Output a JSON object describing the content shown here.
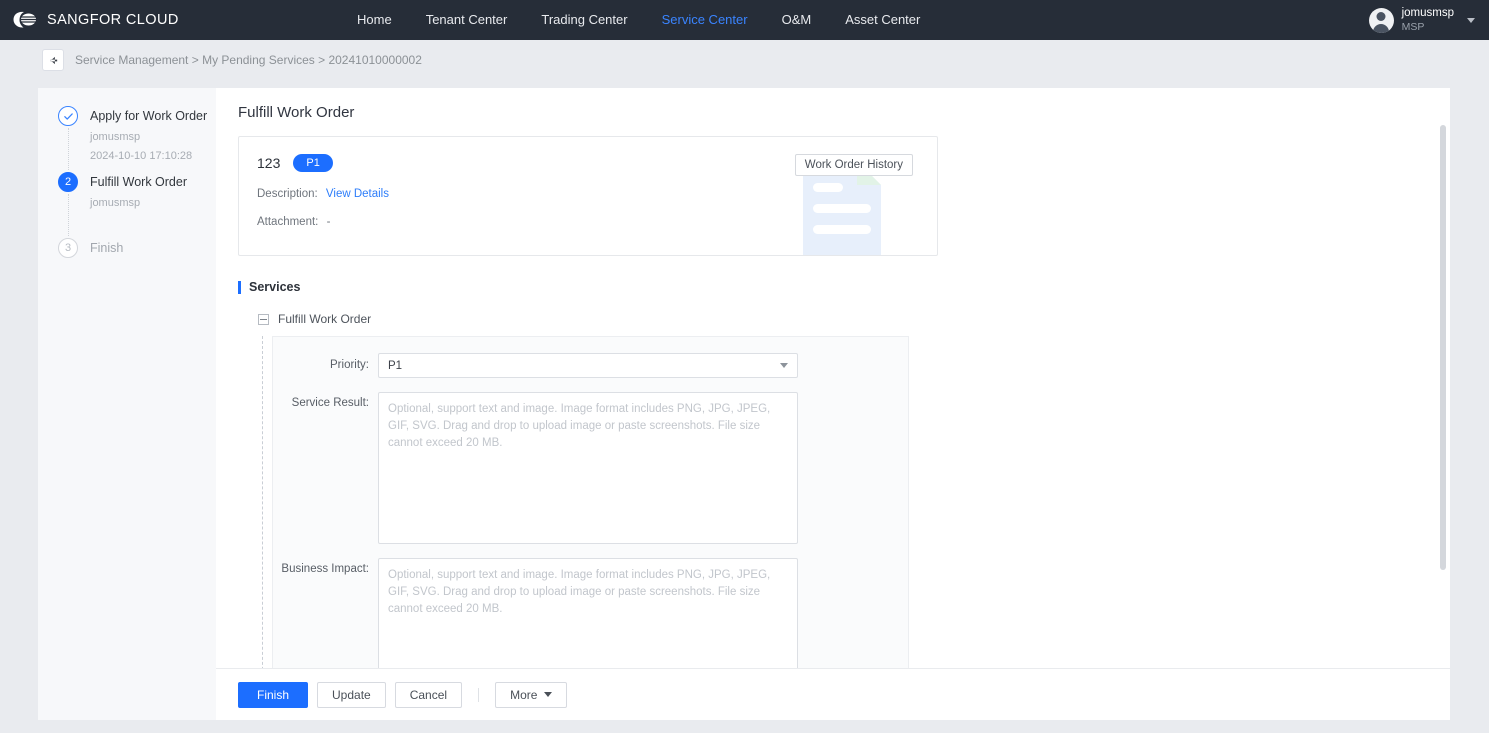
{
  "topnav": {
    "brand": "SANGFOR CLOUD",
    "logo_icon": "sangfor-cloud-logo",
    "items": [
      {
        "label": "Home",
        "active": false
      },
      {
        "label": "Tenant Center",
        "active": false
      },
      {
        "label": "Trading Center",
        "active": false
      },
      {
        "label": "Service Center",
        "active": true
      },
      {
        "label": "O&M",
        "active": false
      },
      {
        "label": "Asset Center",
        "active": false
      }
    ],
    "user": {
      "name": "jomusmsp",
      "role": "MSP",
      "avatar_icon": "user-avatar-icon",
      "caret_icon": "chevron-down-icon"
    },
    "accent": "#3a84ff",
    "background": "#262d38"
  },
  "breadcrumb": {
    "back_icon": "arrow-left-icon",
    "path": "Service Management > My Pending Services > 20241010000002"
  },
  "steps": [
    {
      "marker": "✓",
      "title": "Apply for Work Order",
      "user": "jomusmsp",
      "time": "2024-10-10 17:10:28",
      "state": "done"
    },
    {
      "marker": "2",
      "title": "Fulfill Work Order",
      "user": "jomusmsp",
      "time": "",
      "state": "active"
    },
    {
      "marker": "3",
      "title": "Finish",
      "user": "",
      "time": "",
      "state": "todo"
    }
  ],
  "main": {
    "title": "Fulfill Work Order",
    "summary": {
      "id": "123",
      "priority_badge": "P1",
      "history_button": "Work Order History",
      "description_label": "Description:",
      "description_link": "View Details",
      "attachment_label": "Attachment:",
      "attachment_value": "-",
      "watermark_icon": "document-watermark-icon"
    },
    "section": {
      "title": "Services",
      "group_title": "Fulfill Work Order",
      "collapse_icon": "collapse-minus-icon"
    },
    "form": {
      "priority": {
        "label": "Priority:",
        "value": "P1",
        "arrow_icon": "chevron-down-icon"
      },
      "service_result": {
        "label": "Service Result:",
        "value": "",
        "placeholder": "Optional, support text and image. Image format includes PNG, JPG, JPEG, GIF, SVG. Drag and drop to upload image or paste screenshots. File size cannot exceed 20 MB."
      },
      "business_impact": {
        "label": "Business Impact:",
        "value": "",
        "placeholder": "Optional, support text and image. Image format includes PNG, JPG, JPEG, GIF, SVG. Drag and drop to upload image or paste screenshots. File size cannot exceed 20 MB."
      }
    }
  },
  "footer": {
    "finish": "Finish",
    "update": "Update",
    "cancel": "Cancel",
    "more": "More",
    "more_arrow_icon": "chevron-down-icon",
    "primary_color": "#1c6eff"
  }
}
